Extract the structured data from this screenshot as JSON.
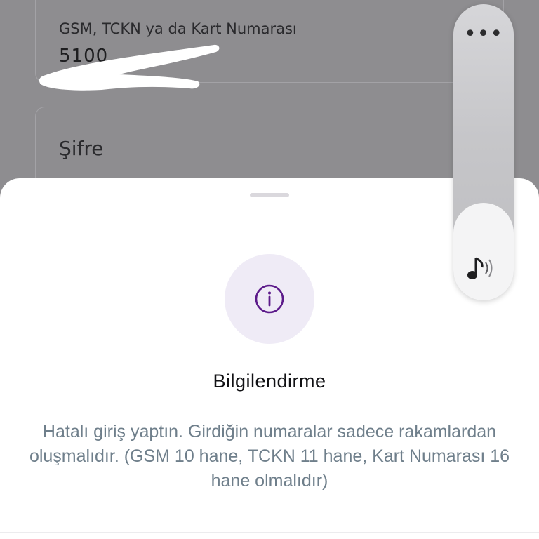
{
  "login_form": {
    "gsm_field": {
      "label": "GSM, TCKN ya da Kart Numarası",
      "value": "5100"
    },
    "password_field": {
      "label": "Şifre"
    }
  },
  "bottom_sheet": {
    "icon": "info-icon",
    "title": "Bilgilendirme",
    "message": "Hatalı giriş yaptın. Girdiğin numaralar sadece rakamlardan oluşmalıdır. (GSM  10 hane, TCKN 11 hane, Kart Numarası 16 hane olmalıdır)"
  },
  "volume_overlay": {
    "more_label": "•••",
    "icon": "music-note-icon",
    "level_percent": 33
  },
  "colors": {
    "accent_purple": "#5c1a8a",
    "message_gray": "#6f7f8b",
    "scrim": "#8e8d90"
  }
}
